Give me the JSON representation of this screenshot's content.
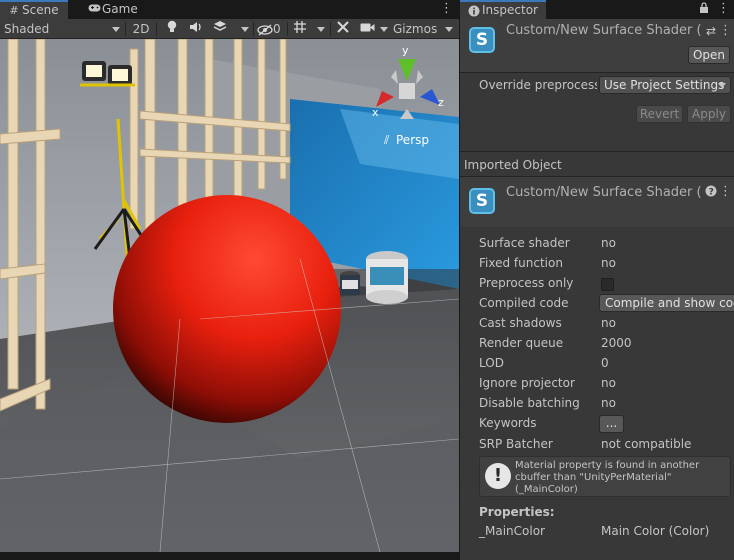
{
  "scene_tabs": [
    {
      "label": "Scene",
      "icon": "grid-icon",
      "active": true
    },
    {
      "label": "Game",
      "icon": "gamepad-icon",
      "active": false
    }
  ],
  "scene_toolbar": {
    "shading_mode": "Shaded",
    "mode_2d": "2D",
    "hidden_count": "0",
    "gizmos": "Gizmos"
  },
  "viewport": {
    "projection": "Persp",
    "axis_labels": {
      "x": "x",
      "y": "y",
      "z": "z"
    },
    "colors": {
      "sphere": "#e42010",
      "wall_blue": "#1f86c8",
      "axis_x": "#d42a2a",
      "axis_y": "#5fbf2b",
      "axis_z": "#2a56d4"
    }
  },
  "inspector": {
    "tab_label": "Inspector",
    "header": {
      "title": "Custom/New Surface Shader (",
      "open_button": "Open",
      "override_label": "Override preprocesso",
      "override_value": "Use Project Settings",
      "revert_button": "Revert",
      "apply_button": "Apply"
    },
    "imported_object_label": "Imported Object",
    "imported": {
      "title": "Custom/New Surface Shader ("
    },
    "properties": [
      {
        "label": "Surface shader",
        "value": "no"
      },
      {
        "label": "Fixed function",
        "value": "no"
      },
      {
        "label": "Preprocess only",
        "value": ""
      },
      {
        "label": "Compiled code",
        "value": "Compile and show code"
      },
      {
        "label": "Cast shadows",
        "value": "no"
      },
      {
        "label": "Render queue",
        "value": "2000"
      },
      {
        "label": "LOD",
        "value": "0"
      },
      {
        "label": "Ignore projector",
        "value": "no"
      },
      {
        "label": "Disable batching",
        "value": "no"
      },
      {
        "label": "Keywords",
        "value": "..."
      },
      {
        "label": "SRP Batcher",
        "value": "not compatible"
      }
    ],
    "help_message": "Material property is found in another cbuffer than \"UnityPerMaterial\" (_MainColor)",
    "properties_heading": "Properties:",
    "shader_properties": [
      {
        "name": "_MainColor",
        "description": "Main Color (Color)"
      }
    ],
    "accent_color": "#3a79bb"
  }
}
